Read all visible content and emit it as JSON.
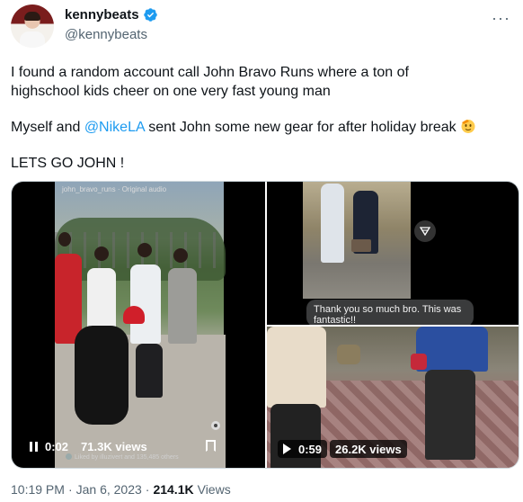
{
  "author": {
    "display_name": "kennybeats",
    "handle": "@kennybeats",
    "verified_color": "#1d9bf0"
  },
  "tweet": {
    "line1_part1": "I found a random account call John Bravo Runs where a ton of",
    "line1_part2": "highschool kids cheer on one very fast young man",
    "line2_pre": "Myself and ",
    "line2_mention": "@NikeLA",
    "line2_post": " sent John some new gear for after holiday break ",
    "line3": "LETS GO JOHN !"
  },
  "media": {
    "main_video": {
      "overlay_text": "john_bravo_runs · Original audio",
      "time": "0:02",
      "views": "71.3K views",
      "liked_by": "Liked by illuzivert and 135,485 others"
    },
    "top_video": {
      "chat_text": "Thank you so much bro. This was fantastic!!"
    },
    "bottom_video": {
      "time": "0:59",
      "views": "26.2K views"
    }
  },
  "meta": {
    "time": "10:19 PM",
    "dot1": "·",
    "date": "Jan 6, 2023",
    "dot2": "·",
    "views_count": "214.1K",
    "views_label": "Views"
  }
}
